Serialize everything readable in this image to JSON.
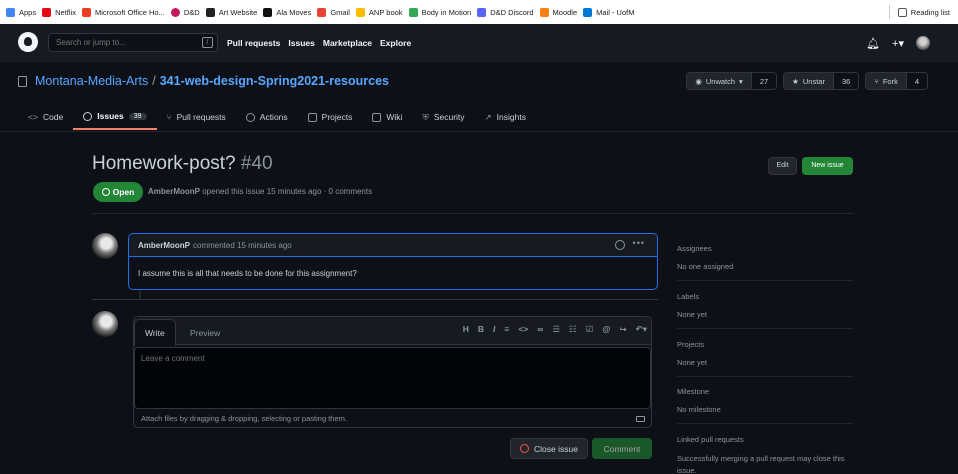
{
  "bookmarks": [
    {
      "label": "Apps",
      "color": "#4285f4"
    },
    {
      "label": "Netflix",
      "color": "#e50914"
    },
    {
      "label": "Microsoft Office Ho...",
      "color": "#ea3e23"
    },
    {
      "label": "D&D",
      "color": "#c2185b"
    },
    {
      "label": "Art Website",
      "color": "#222222"
    },
    {
      "label": "Ala Moves",
      "color": "#111111"
    },
    {
      "label": "Gmail",
      "color": "#ea4335"
    },
    {
      "label": "ANP book",
      "color": "#fbbc04"
    },
    {
      "label": "Body in Motion",
      "color": "#34a853"
    },
    {
      "label": "D&D Discord",
      "color": "#5865f2"
    },
    {
      "label": "Moodle",
      "color": "#f98012"
    },
    {
      "label": "Mail - UofM",
      "color": "#0078d4"
    }
  ],
  "reading_list": "Reading list",
  "header": {
    "search_placeholder": "Search or jump to...",
    "slash": "/",
    "nav": [
      "Pull requests",
      "Issues",
      "Marketplace",
      "Explore"
    ]
  },
  "repo": {
    "owner": "Montana-Media-Arts",
    "separator": "/",
    "name": "341-web-design-Spring2021-resources",
    "watch_label": "Unwatch",
    "watch_count": "27",
    "star_label": "Unstar",
    "star_count": "36",
    "fork_label": "Fork",
    "fork_count": "4"
  },
  "tabs": [
    {
      "label": "Code",
      "icon": "code-icon"
    },
    {
      "label": "Issues",
      "count": "39",
      "icon": "issue-icon"
    },
    {
      "label": "Pull requests",
      "icon": "pull-request-icon"
    },
    {
      "label": "Actions",
      "icon": "play-icon"
    },
    {
      "label": "Projects",
      "icon": "project-icon"
    },
    {
      "label": "Wiki",
      "icon": "book-icon"
    },
    {
      "label": "Security",
      "icon": "shield-icon"
    },
    {
      "label": "Insights",
      "icon": "graph-icon"
    }
  ],
  "issue": {
    "title": "Homework-post?",
    "number": "#40",
    "edit_label": "Edit",
    "new_issue_label": "New issue",
    "state": "Open",
    "author": "AmberMoonP",
    "meta": "opened this issue 15 minutes ago · 0 comments"
  },
  "comment": {
    "author": "AmberMoonP",
    "action": "commented 15 minutes ago",
    "body": "I assume this is all that needs to be done for this assignment?"
  },
  "editor": {
    "write_tab": "Write",
    "preview_tab": "Preview",
    "placeholder": "Leave a comment",
    "attach_text": "Attach files by dragging & dropping, selecting or pasting them.",
    "close_issue_label": "Close issue",
    "comment_label": "Comment"
  },
  "sidebar": {
    "assignees_h": "Assignees",
    "assignees_v": "No one assigned",
    "labels_h": "Labels",
    "labels_v": "None yet",
    "projects_h": "Projects",
    "projects_v": "None yet",
    "milestone_h": "Milestone",
    "milestone_v": "No milestone",
    "linked_h": "Linked pull requests",
    "linked_v": "Successfully merging a pull request may close this issue."
  },
  "colors": {
    "accent_blue": "#58a6ff",
    "open_green": "#238636",
    "tab_underline": "#f78166",
    "background": "#0d1117"
  }
}
